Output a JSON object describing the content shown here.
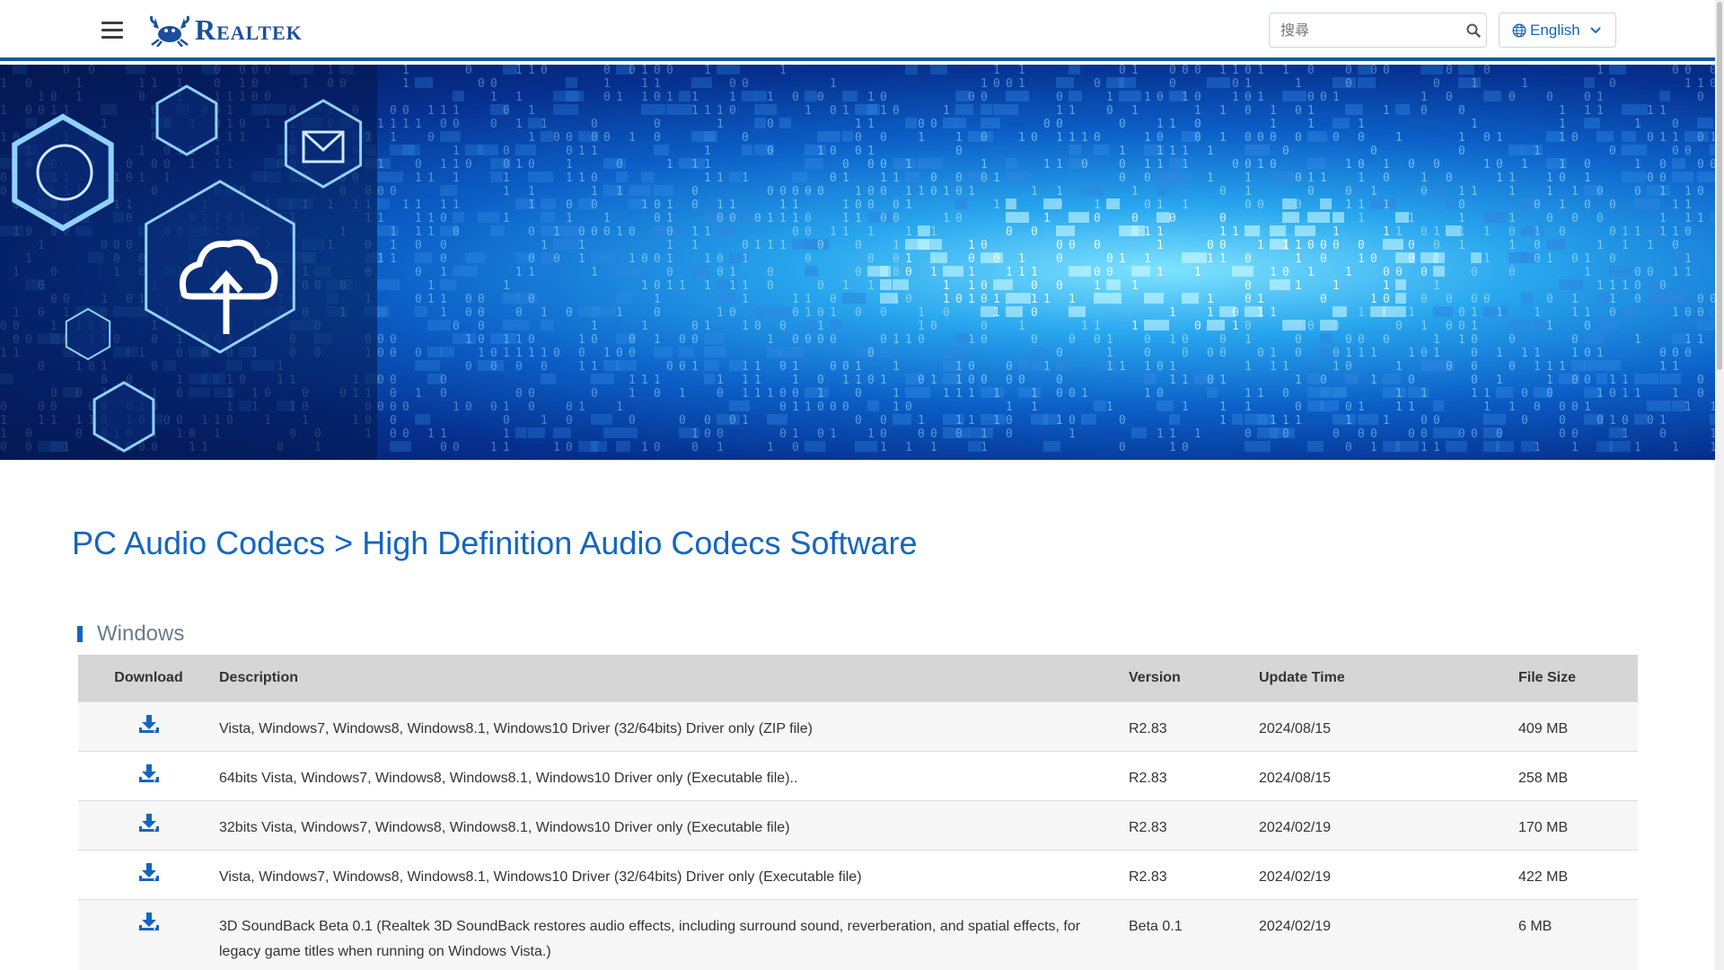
{
  "header": {
    "logo_text": "Realtek",
    "search_placeholder": "搜尋",
    "language": "English",
    "icons": {
      "menu": "hamburger-icon",
      "search": "search-icon",
      "globe": "globe-icon",
      "chevron": "chevron-down-icon"
    }
  },
  "page": {
    "title": "PC Audio Codecs > High Definition Audio Codecs Software",
    "section": "Windows"
  },
  "table": {
    "headers": {
      "download": "Download",
      "description": "Description",
      "version": "Version",
      "update_time": "Update Time",
      "file_size": "File Size"
    },
    "rows": [
      {
        "description": "Vista, Windows7, Windows8, Windows8.1, Windows10 Driver (32/64bits) Driver only (ZIP file)",
        "version": "R2.83",
        "update_time": "2024/08/15",
        "file_size": "409 MB"
      },
      {
        "description": "64bits Vista, Windows7, Windows8, Windows8.1, Windows10 Driver only (Executable file)..",
        "version": "R2.83",
        "update_time": "2024/08/15",
        "file_size": "258 MB"
      },
      {
        "description": "32bits Vista, Windows7, Windows8, Windows8.1, Windows10 Driver only (Executable file)",
        "version": "R2.83",
        "update_time": "2024/02/19",
        "file_size": "170 MB"
      },
      {
        "description": "Vista, Windows7, Windows8, Windows8.1, Windows10 Driver (32/64bits) Driver only (Executable file)",
        "version": "R2.83",
        "update_time": "2024/02/19",
        "file_size": "422 MB"
      },
      {
        "description": "3D SoundBack Beta 0.1 (Realtek 3D SoundBack restores audio effects, including surround sound, reverberation, and spatial effects, for legacy game titles when running on Windows Vista.)",
        "version": "Beta 0.1",
        "update_time": "2024/02/19",
        "file_size": "6 MB"
      }
    ]
  },
  "colors": {
    "brand_blue": "#1565c0",
    "header_rule": "#0a5aa8",
    "table_header_bg": "#d6d6d6"
  }
}
